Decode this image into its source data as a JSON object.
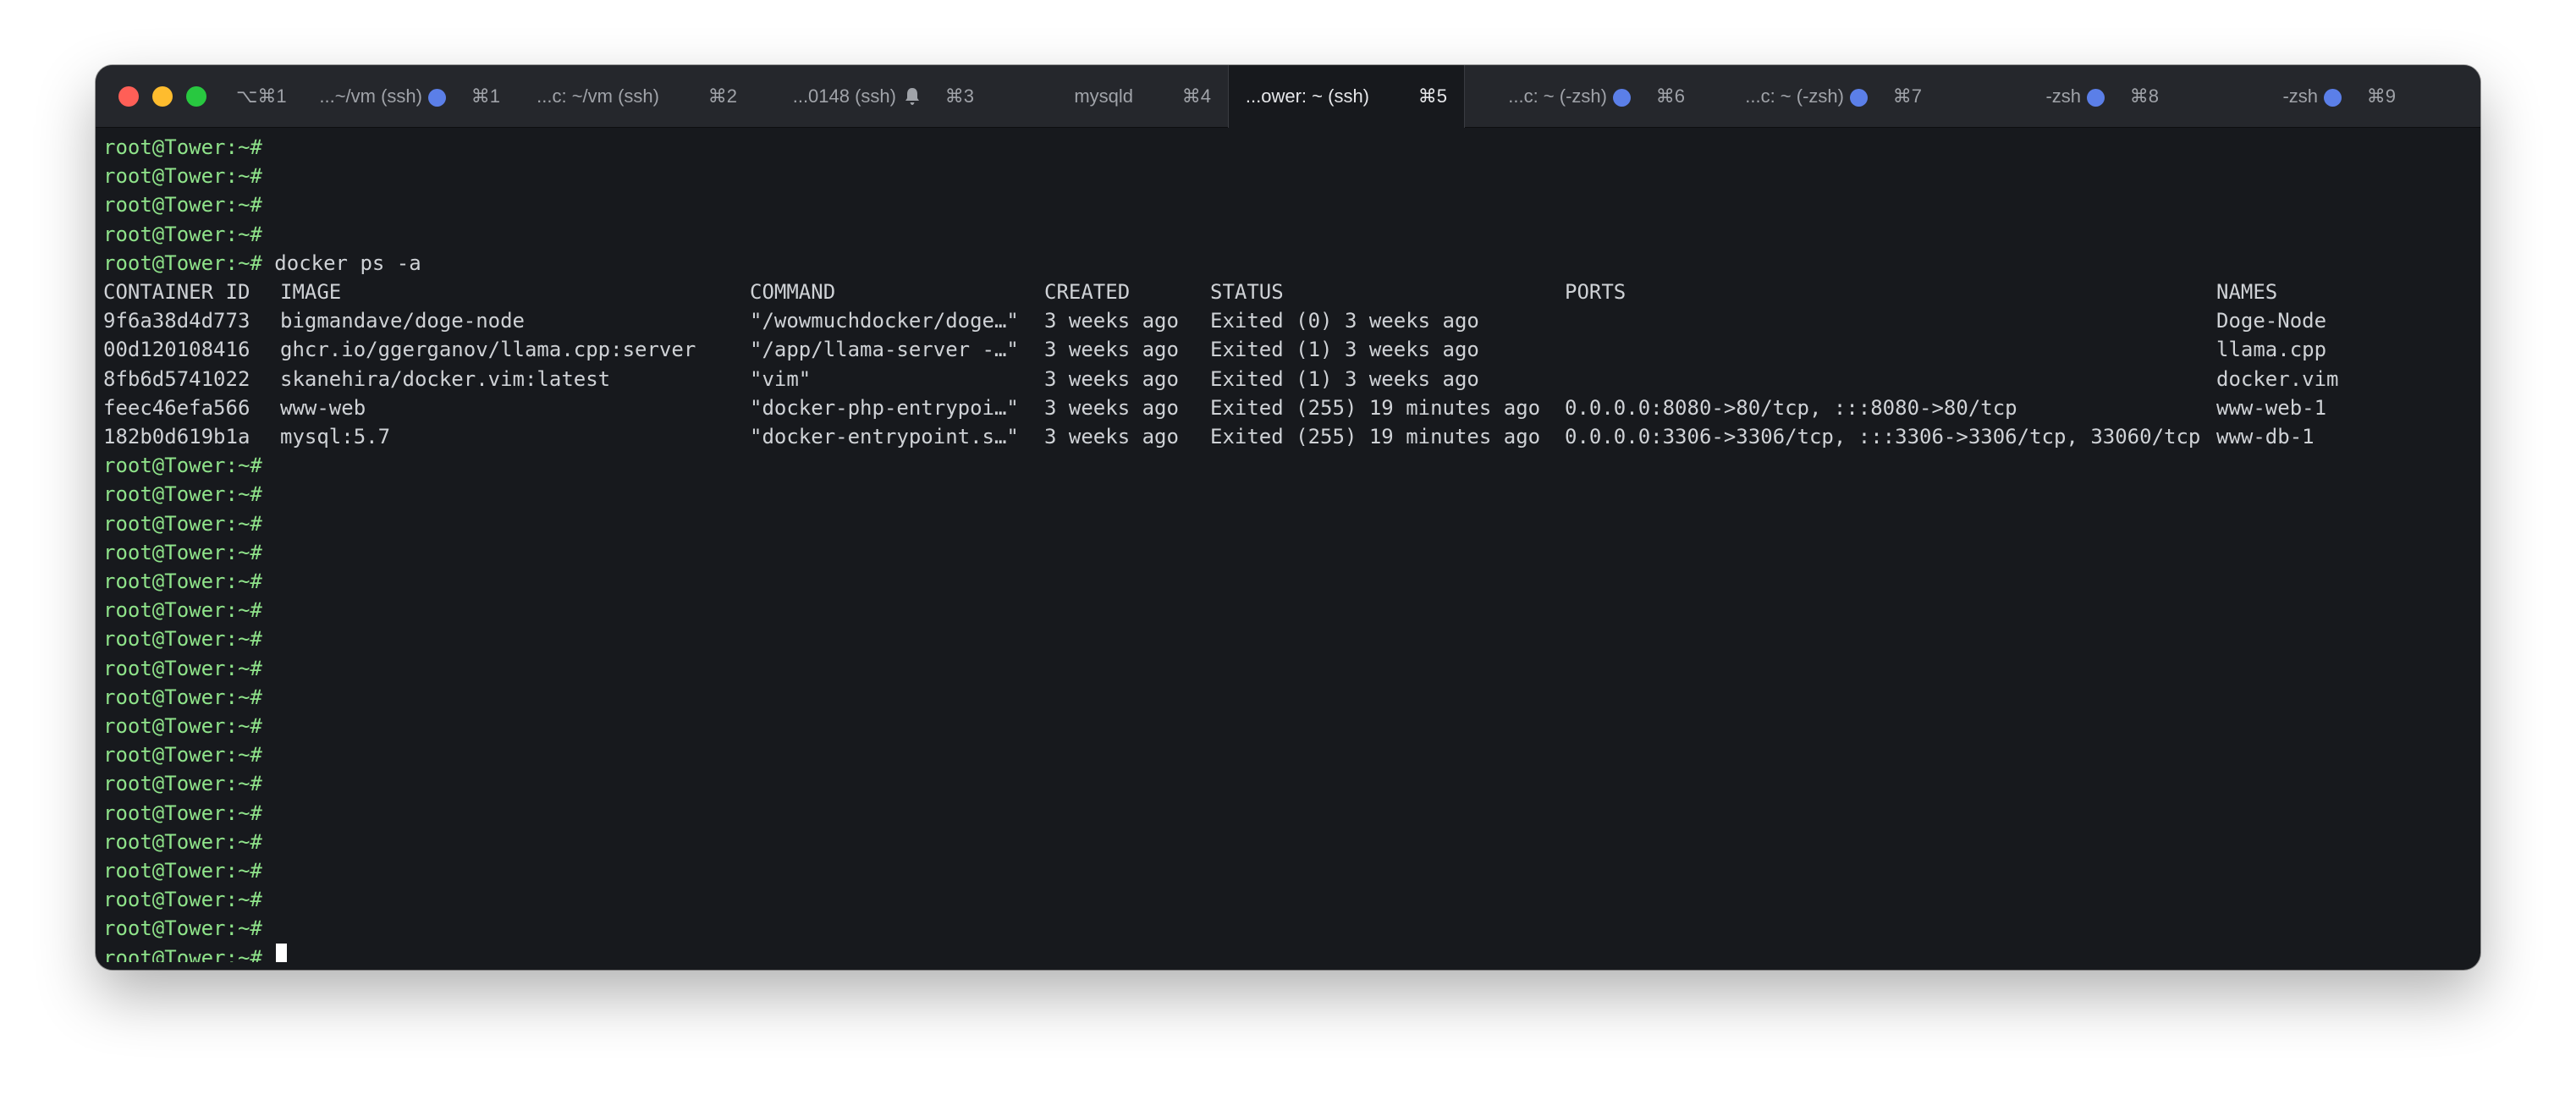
{
  "window": {
    "shortcut": "⌥⌘1",
    "colors": {
      "background": "#17191d",
      "tabbar": "#25272c",
      "prompt": "#8fe38a",
      "indicator": "#5b7fe8"
    }
  },
  "tabs": [
    {
      "title": "...~/vm (ssh)",
      "indicator": "dot",
      "shortcut": "⌘1"
    },
    {
      "title": "...c: ~/vm (ssh)",
      "indicator": "",
      "shortcut": "⌘2"
    },
    {
      "title": "...0148 (ssh)",
      "indicator": "bell",
      "shortcut": "⌘3"
    },
    {
      "title": "mysqld",
      "indicator": "",
      "shortcut": "⌘4"
    },
    {
      "title": "...ower: ~ (ssh)",
      "indicator": "",
      "shortcut": "⌘5",
      "active": true
    },
    {
      "title": "...c: ~ (-zsh)",
      "indicator": "dot",
      "shortcut": "⌘6"
    },
    {
      "title": "...c: ~ (-zsh)",
      "indicator": "dot",
      "shortcut": "⌘7"
    },
    {
      "title": "-zsh",
      "indicator": "dot",
      "shortcut": "⌘8"
    },
    {
      "title": "-zsh",
      "indicator": "dot",
      "shortcut": "⌘9"
    }
  ],
  "terminal": {
    "prompt": "root@Tower:~#",
    "lines_before": [
      "",
      "",
      "",
      ""
    ],
    "command": "docker ps -a",
    "table": {
      "headers": [
        "CONTAINER ID",
        "IMAGE",
        "COMMAND",
        "CREATED",
        "STATUS",
        "PORTS",
        "NAMES"
      ],
      "rows": [
        [
          "9f6a38d4d773",
          "bigmandave/doge-node",
          "\"/wowmuchdocker/doge…\"",
          "3 weeks ago",
          "Exited (0) 3 weeks ago",
          "",
          "Doge-Node"
        ],
        [
          "00d120108416",
          "ghcr.io/ggerganov/llama.cpp:server",
          "\"/app/llama-server -…\"",
          "3 weeks ago",
          "Exited (1) 3 weeks ago",
          "",
          "llama.cpp"
        ],
        [
          "8fb6d5741022",
          "skanehira/docker.vim:latest",
          "\"vim\"",
          "3 weeks ago",
          "Exited (1) 3 weeks ago",
          "",
          "docker.vim"
        ],
        [
          "feec46efa566",
          "www-web",
          "\"docker-php-entrypoi…\"",
          "3 weeks ago",
          "Exited (255) 19 minutes ago",
          "0.0.0.0:8080->80/tcp, :::8080->80/tcp",
          "www-web-1"
        ],
        [
          "182b0d619b1a",
          "mysql:5.7",
          "\"docker-entrypoint.s…\"",
          "3 weeks ago",
          "Exited (255) 19 minutes ago",
          "0.0.0.0:3306->3306/tcp, :::3306->3306/tcp, 33060/tcp",
          "www-db-1"
        ]
      ]
    },
    "lines_after": [
      "",
      "",
      "",
      "",
      "",
      "",
      "",
      "",
      "",
      "",
      "",
      "",
      "",
      "",
      "",
      "",
      "",
      ""
    ]
  }
}
